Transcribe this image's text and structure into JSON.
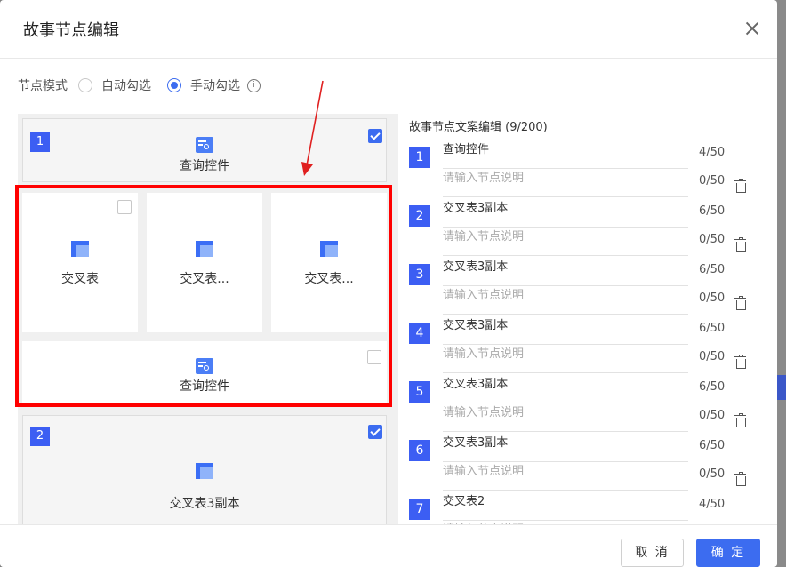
{
  "dialog": {
    "title": "故事节点编辑"
  },
  "mode": {
    "label": "节点模式",
    "options": [
      {
        "label": "自动勾选",
        "checked": false
      },
      {
        "label": "手动勾选",
        "checked": true
      }
    ],
    "info_icon": "info-circle-icon"
  },
  "left_cards": {
    "group1": {
      "number": "1",
      "label": "查询控件",
      "checked": true
    },
    "sub_cards": [
      {
        "label": "交叉表",
        "checked": false
      },
      {
        "label": "交叉表..."
      },
      {
        "label": "交叉表..."
      }
    ],
    "sub_query": {
      "label": "查询控件",
      "checked": false
    },
    "group2": {
      "number": "2",
      "label": "交叉表3副本",
      "checked": true
    }
  },
  "right": {
    "title": "故事节点文案编辑 (9/200)",
    "desc_placeholder": "请输入节点说明",
    "items": [
      {
        "number": "1",
        "name": "查询控件",
        "name_count": "4/50",
        "desc_count": "0/50"
      },
      {
        "number": "2",
        "name": "交叉表3副本",
        "name_count": "6/50",
        "desc_count": "0/50"
      },
      {
        "number": "3",
        "name": "交叉表3副本",
        "name_count": "6/50",
        "desc_count": "0/50"
      },
      {
        "number": "4",
        "name": "交叉表3副本",
        "name_count": "6/50",
        "desc_count": "0/50"
      },
      {
        "number": "5",
        "name": "交叉表3副本",
        "name_count": "6/50",
        "desc_count": "0/50"
      },
      {
        "number": "6",
        "name": "交叉表3副本",
        "name_count": "6/50",
        "desc_count": "0/50"
      },
      {
        "number": "7",
        "name": "交叉表2",
        "name_count": "4/50",
        "desc_count": ""
      }
    ]
  },
  "footer": {
    "cancel_label": "取 消",
    "ok_label": "确 定"
  },
  "colors": {
    "accent": "#3c6cf0",
    "badge": "#3c5ef3",
    "highlight": "#ff0000"
  }
}
